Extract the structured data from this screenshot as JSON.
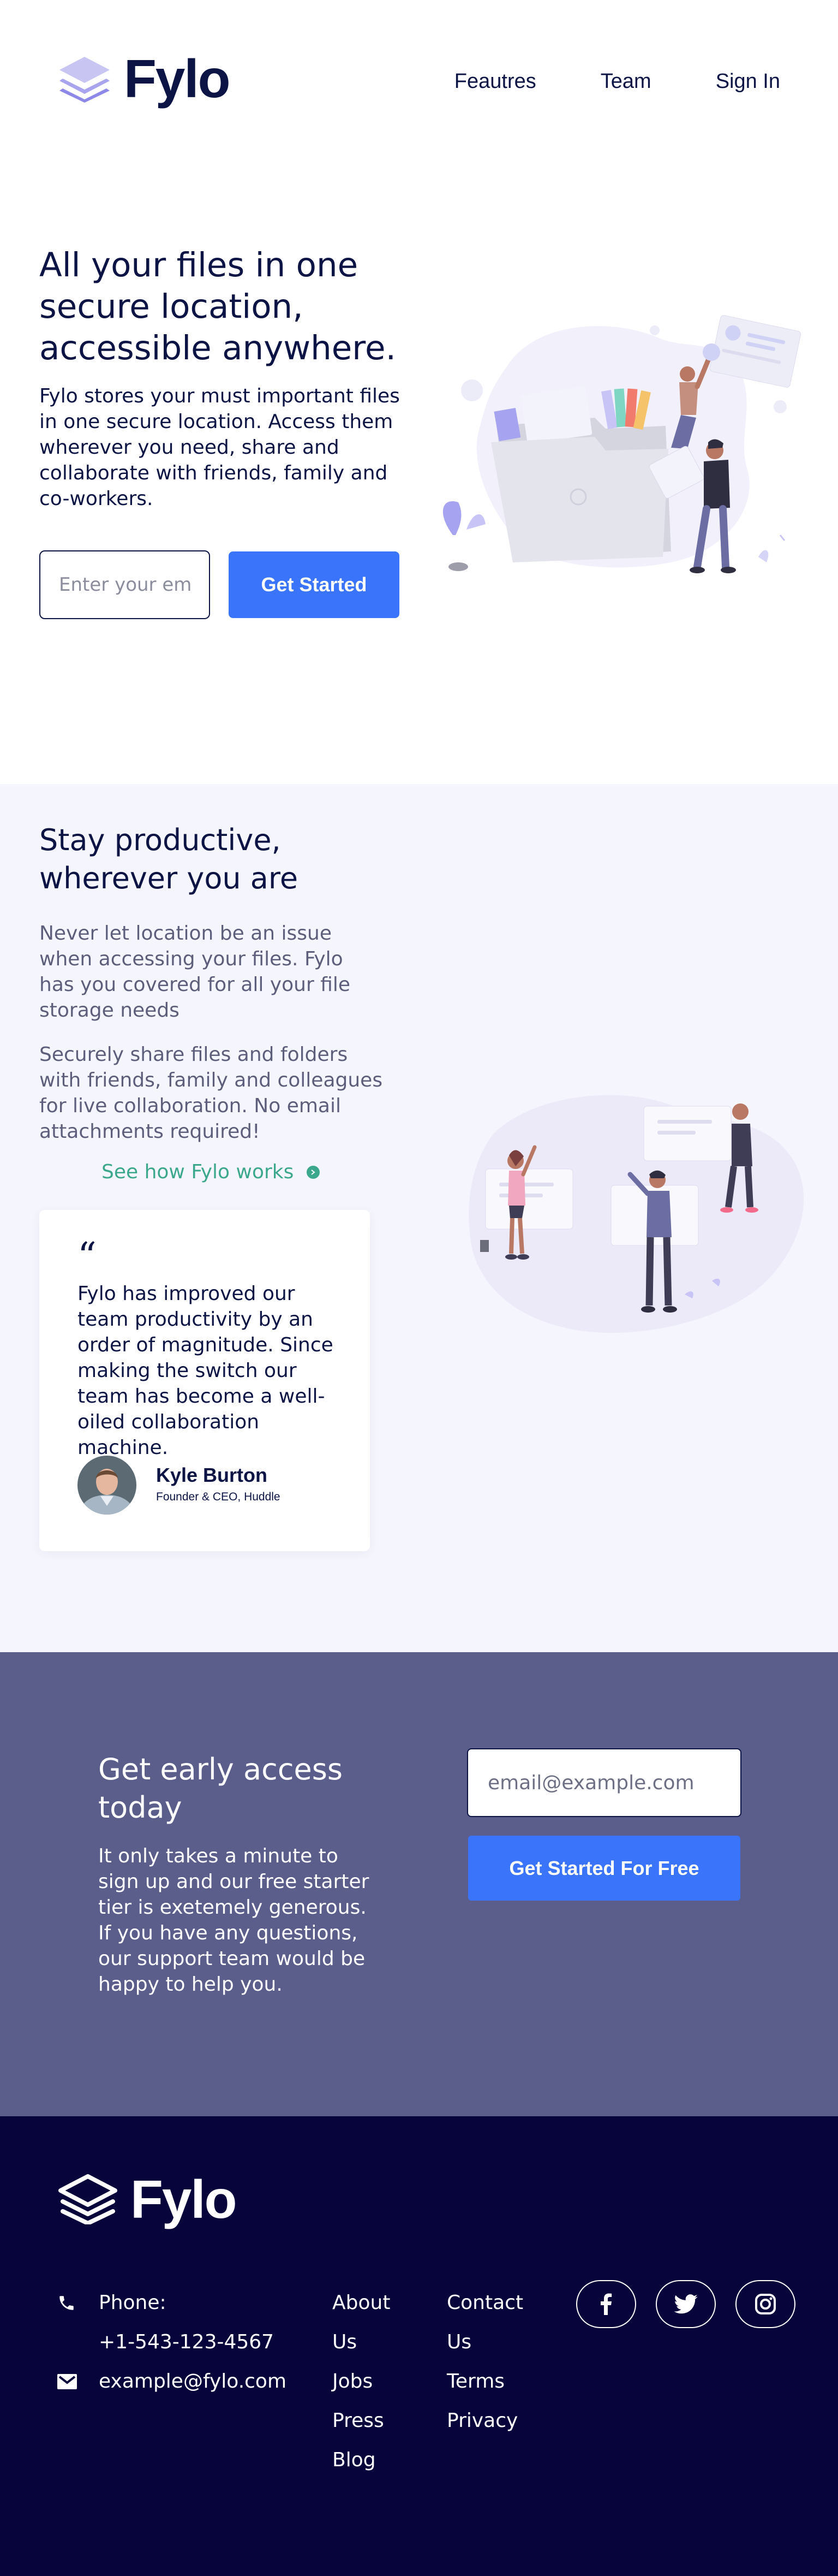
{
  "header": {
    "logo_text": "Fylo",
    "nav": [
      {
        "label": "Feautres"
      },
      {
        "label": "Team"
      },
      {
        "label": "Sign In"
      }
    ]
  },
  "hero": {
    "title": "All your files in one secure location, accessible anywhere.",
    "text": "Fylo stores your must important files in one secure location. Access them wherever you need, share and collaborate with friends, family and co-workers.",
    "email_placeholder": "Enter your email...",
    "cta_label": "Get Started"
  },
  "productive": {
    "title": "Stay productive, wherever you are",
    "p1": "Never let location be an issue when accessing your files. Fylo has you covered for all your file storage needs",
    "p2": "Securely share files and folders with friends, family and colleagues for live collaboration. No email attachments required!",
    "link_label": "See how Fylo works",
    "testimonial": {
      "quote_mark": "“",
      "text": "Fylo has improved our team productivity by an order of magnitude. Since making the switch our team has become a well-oiled collaboration machine.",
      "name": "Kyle Burton",
      "role": "Founder & CEO, Huddle"
    }
  },
  "early_access": {
    "title": "Get early access today",
    "text": "It only takes a minute to sign up and our free starter tier is exetemely generous. If you have any questions, our support team would be happy to help you.",
    "email_placeholder": "email@example.com",
    "cta_label": "Get Started For Free"
  },
  "footer": {
    "logo_text": "Fylo",
    "phone_label": "Phone:",
    "phone_number": "+1-543-123-4567",
    "email": "example@fylo.com",
    "links_col1": [
      "About Us",
      "Jobs",
      "Press",
      "Blog"
    ],
    "links_col2": [
      "Contact Us",
      "Terms",
      "Privacy"
    ],
    "socials": [
      "facebook-icon",
      "twitter-icon",
      "instagram-icon"
    ]
  },
  "colors": {
    "navy": "#0c1445",
    "accent_blue": "#3a74fa",
    "teal_link": "#3ba88e",
    "section_bg": "#f5f5fd",
    "cta_bg": "#5b5d8b",
    "footer_bg": "#07043b"
  }
}
